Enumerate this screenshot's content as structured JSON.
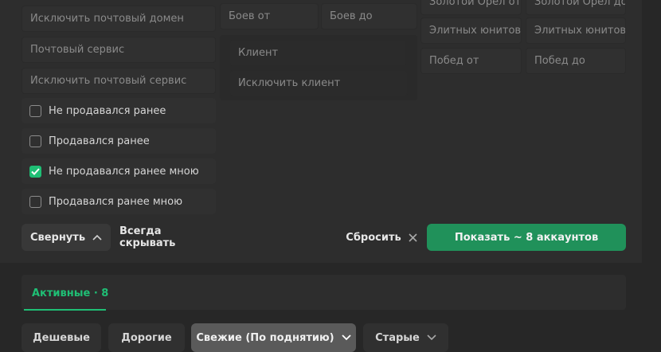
{
  "filters": {
    "exclude_mail_domain": "Исключить почтовый домен",
    "mail_service": "Почтовый сервис",
    "exclude_mail_service": "Исключить почтовый сервис",
    "battles_from": "Боев от",
    "battles_to": "Боев до",
    "client": "Клиент",
    "exclude_client": "Исключить клиент",
    "golden_eagle_from": "Золотой Орел от",
    "golden_eagle_to": "Золотой Орел до",
    "elite_units_from": "Элитных юнитов",
    "elite_units_to": "Элитных юнитов",
    "wins_from": "Побед от",
    "wins_to": "Побед до"
  },
  "checkboxes": [
    {
      "label": "Не продавался ранее",
      "checked": false
    },
    {
      "label": "Продавался ранее",
      "checked": false
    },
    {
      "label": "Не продавался ранее мною",
      "checked": true
    },
    {
      "label": "Продавался ранее мною",
      "checked": false
    }
  ],
  "actions": {
    "collapse_label": "Свернуть",
    "always_hide_label": "Всегда скрывать",
    "reset_label": "Сбросить",
    "show_label": "Показать ~ 8 аккаунтов"
  },
  "tabs": {
    "active_label": "Активные · 8"
  },
  "sort": {
    "cheap": "Дешевые",
    "expensive": "Дорогие",
    "fresh": "Свежие (По поднятию)",
    "old": "Старые"
  },
  "colors": {
    "accent": "#1fbf75",
    "primary_button": "#20915a"
  }
}
